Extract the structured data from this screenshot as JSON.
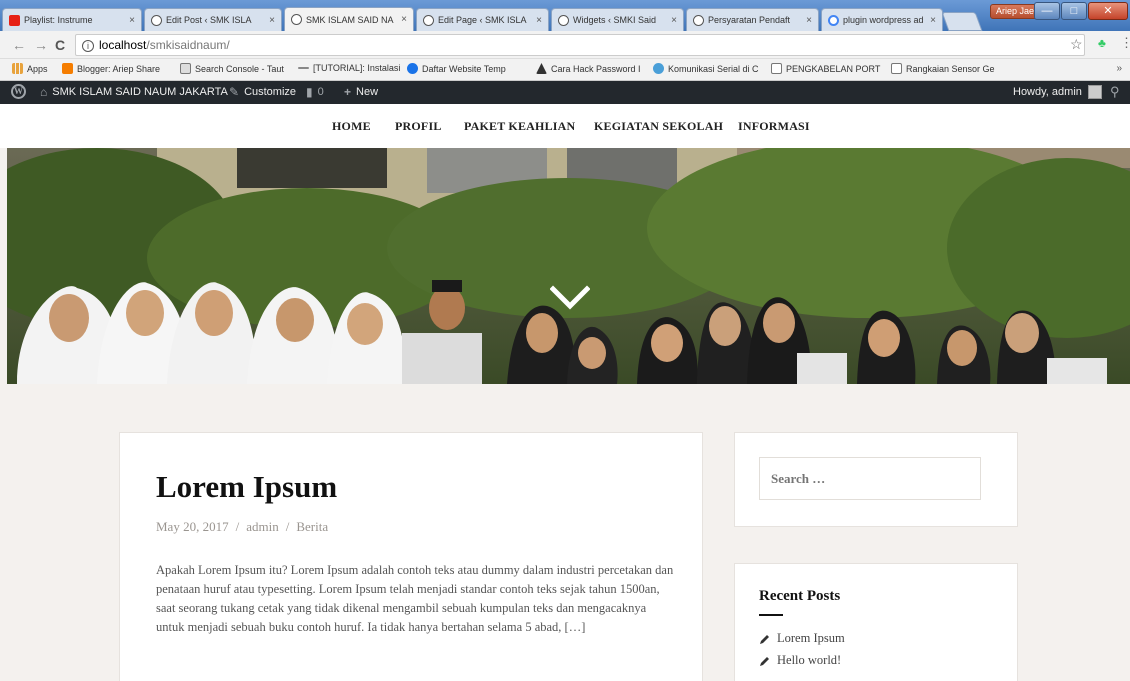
{
  "browser": {
    "tabs": [
      {
        "title": "Playlist: Instrume",
        "favicon_color": "#e62117",
        "active": false
      },
      {
        "title": "Edit Post ‹ SMK ISLA",
        "favicon_color": "#555555",
        "active": false
      },
      {
        "title": "SMK ISLAM SAID NA",
        "favicon_color": "#555555",
        "active": true
      },
      {
        "title": "Edit Page ‹ SMK ISLA",
        "favicon_color": "#555555",
        "active": false
      },
      {
        "title": "Widgets ‹ SMKI Said",
        "favicon_color": "#555555",
        "active": false
      },
      {
        "title": "Persyaratan Pendaft",
        "favicon_color": "#555555",
        "active": false
      },
      {
        "title": "plugin wordpress ad",
        "favicon_color": "#4285f4",
        "active": false
      }
    ],
    "tab_close": "×",
    "profile_name": "Ariep Jaenul",
    "window_buttons": {
      "minimize": "—",
      "maximize": "□",
      "close": "✕"
    },
    "nav": {
      "back": "←",
      "forward": "→",
      "reload": "C"
    },
    "url_host": "localhost",
    "url_path": "/smkisaidnaum/",
    "bookmarks": [
      {
        "label": "Apps",
        "icon_color": "#e8a33d"
      },
      {
        "label": "Blogger: Ariep Share",
        "icon_color": "#f57d00"
      },
      {
        "label": "Search Console - Taut",
        "icon_color": "#666666"
      },
      {
        "label": "[TUTORIAL]: Instalasi",
        "icon_color": "#888888"
      },
      {
        "label": "Daftar Website Temp",
        "icon_color": "#1a73e8"
      },
      {
        "label": "Cara Hack Password I",
        "icon_color": "#333333"
      },
      {
        "label": "Komunikasi Serial di C",
        "icon_color": "#4a9fd8"
      },
      {
        "label": "PENGKABELAN PORT",
        "icon_color": "#ffffff"
      },
      {
        "label": "Rangkaian Sensor Ge",
        "icon_color": "#ffffff"
      }
    ],
    "bookmarks_more": "»"
  },
  "adminbar": {
    "site_name": "SMK ISLAM SAID NAUM JAKARTA",
    "customize": "Customize",
    "comments_count": "0",
    "new_label": "New",
    "howdy": "Howdy, admin"
  },
  "menu": [
    "HOME",
    "PROFIL",
    "PAKET KEAHLIAN",
    "KEGIATAN SEKOLAH",
    "INFORMASI"
  ],
  "post": {
    "title": "Lorem Ipsum",
    "date": "May 20, 2017",
    "author": "admin",
    "category": "Berita",
    "separator": "/",
    "excerpt": "Apakah Lorem Ipsum itu? Lorem Ipsum adalah contoh teks atau dummy dalam industri percetakan dan penataan huruf atau typesetting. Lorem Ipsum telah menjadi standar contoh teks sejak tahun 1500an, saat seorang tukang cetak yang tidak dikenal mengambil sebuah kumpulan teks dan mengacaknya untuk menjadi sebuah buku contoh huruf. Ia tidak hanya bertahan selama 5 abad, […]"
  },
  "sidebar": {
    "search_placeholder": "Search …",
    "recent_title": "Recent Posts",
    "recent_posts": [
      "Lorem Ipsum",
      "Hello world!"
    ]
  },
  "colors": {
    "adminbar_bg": "#23282d",
    "page_bg": "#f4f1ee",
    "card_bg": "#ffffff"
  }
}
